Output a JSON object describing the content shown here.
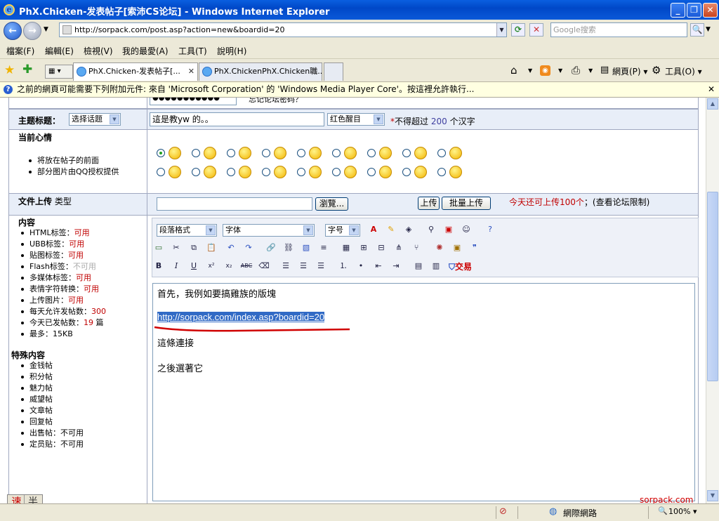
{
  "window": {
    "title": "PhX.Chicken-发表帖子[索沛CS论坛] - Windows Internet Explorer"
  },
  "address": {
    "url": "http://sorpack.com/post.asp?action=new&boardid=20",
    "search_placeholder": "Google搜索"
  },
  "menu": [
    "檔案(F)",
    "編輯(E)",
    "檢視(V)",
    "我的最愛(A)",
    "工具(T)",
    "說明(H)"
  ],
  "tabs": [
    {
      "label": "PhX.Chicken-发表帖子[..."
    },
    {
      "label": "PhX.ChickenPhX.Chicken職..."
    }
  ],
  "toolbar_right": {
    "page_label": "網頁(P)",
    "tools_label": "工具(O)"
  },
  "infobar": {
    "text": "之前的網頁可能需要下列附加元件: 來自 'Microsoft Corporation' 的 'Windows Media Player Core'。按這裡允許執行..."
  },
  "form": {
    "password_value": "●●●●●●●●●●●",
    "forgot_password": "忘记论坛密码？",
    "subject_label": "主题标题：",
    "topic_select": "选择话题",
    "subject_value": "這是教yw 的。。",
    "color_select": "红色醒目",
    "limit_star": "*",
    "limit_prefix": "不得超过",
    "limit_num": "200",
    "limit_suffix": "个汉字",
    "mood_label": "当前心情",
    "mood_notes": [
      "将放在帖子的前面",
      "部分图片由QQ授权提供"
    ],
    "upload_label": "文件上传",
    "upload_type": "类型",
    "browse_button": "瀏覽...",
    "upload_button": "上传",
    "batch_upload_button": "批量上传",
    "upload_info": "今天还可上传100个",
    "upload_limit_link": "；(查看论坛限制)",
    "content_label": "内容",
    "content_rules": [
      {
        "label": "HTML标签：",
        "value": "可用"
      },
      {
        "label": "UBB标签：",
        "value": "可用"
      },
      {
        "label": "贴图标签：",
        "value": "可用"
      },
      {
        "label": "Flash标签：",
        "value": "不可用"
      },
      {
        "label": "多媒体标签：",
        "value": "可用"
      },
      {
        "label": "表情字符转换：",
        "value": "可用"
      },
      {
        "label": "上传图片：",
        "value": "可用"
      },
      {
        "label": "每天允许发帖数：",
        "value": "300"
      },
      {
        "label": "今天已发帖数：",
        "value": "19",
        "suffix": " 篇"
      },
      {
        "label": "最多：",
        "value": "15KB"
      }
    ],
    "special_label": "特殊内容",
    "special_items": [
      "金钱帖",
      "积分帖",
      "魅力帖",
      "威望帖",
      "文章帖",
      "回复帖",
      "出售帖：不可用",
      "定员贴：不可用"
    ]
  },
  "editor_toolbar": {
    "paragraph_select": "段落格式",
    "font_select": "字体",
    "size_select": "字号",
    "trade_label": "交易"
  },
  "editor": {
    "line1": "首先，我例如要搞雞族的版塊",
    "link": "http://sorpack.com/index.asp?boardid=20",
    "line3": "這條連接",
    "line4": "之後選著它"
  },
  "ime": {
    "btn1": "速",
    "btn2": "半"
  },
  "watermark": "sorpack.com",
  "status": {
    "zone": "網際網路",
    "zoom": "100%"
  },
  "colors": {
    "link": "#0000cc",
    "selection": "#316ac5",
    "underline": "#d00000",
    "red_text": "#c00000"
  }
}
